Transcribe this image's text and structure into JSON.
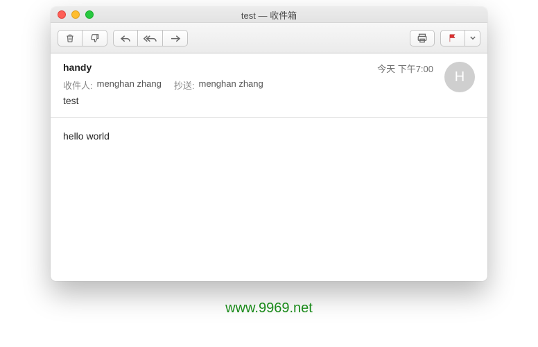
{
  "window": {
    "title": "test — 收件箱"
  },
  "toolbar": {
    "trash": "trash",
    "junk": "junk",
    "reply": "reply",
    "reply_all": "reply-all",
    "forward": "forward",
    "print": "print",
    "flag": "flag",
    "more": "more"
  },
  "message": {
    "sender": "handy",
    "date": "今天 下午7:00",
    "to_label": "收件人:",
    "to_value": "menghan zhang",
    "cc_label": "抄送:",
    "cc_value": "menghan zhang",
    "subject": "test",
    "avatar_initial": "H",
    "body": "hello world"
  },
  "watermark": "www.9969.net"
}
